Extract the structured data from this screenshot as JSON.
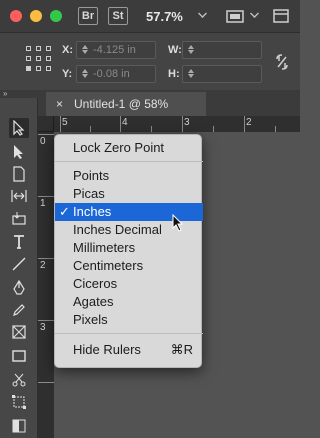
{
  "titlebar": {
    "app_badges": [
      "Br",
      "St"
    ],
    "zoom": "57.7%"
  },
  "control": {
    "x_label": "X:",
    "x_value": "-4.125 in",
    "y_label": "Y:",
    "y_value": "-0.08 in",
    "w_label": "W:",
    "h_label": "H:"
  },
  "tools_header": "»",
  "tab": {
    "close": "×",
    "title": "Untitled-1 @ 58%"
  },
  "ruler": {
    "h": [
      "5",
      "4",
      "3",
      "2"
    ],
    "v": [
      "0",
      "1",
      "2",
      "3"
    ]
  },
  "menu": {
    "lock_zero": "Lock Zero Point",
    "units": [
      "Points",
      "Picas",
      "Inches",
      "Inches Decimal",
      "Millimeters",
      "Centimeters",
      "Ciceros",
      "Agates",
      "Pixels"
    ],
    "selected": "Inches",
    "check": "✓",
    "hide_rulers": "Hide Rulers",
    "hide_shortcut": "⌘R"
  },
  "colors": {
    "selection": "#1c67d8",
    "menu_bg": "#d9d9d9"
  }
}
